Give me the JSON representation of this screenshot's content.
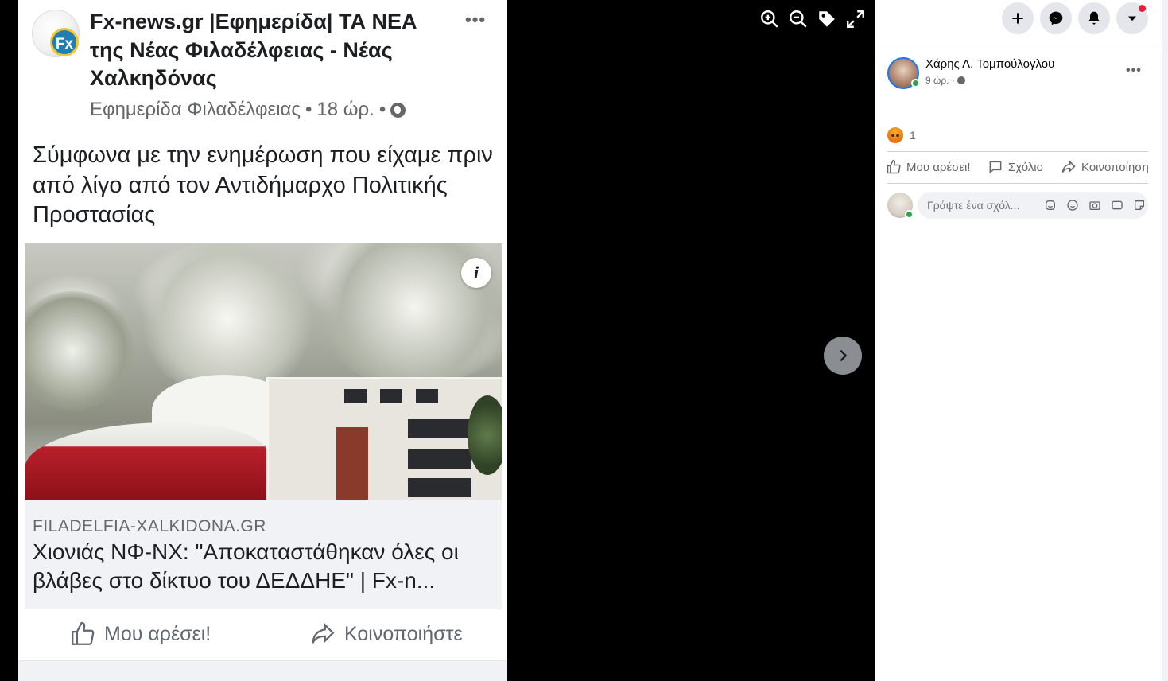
{
  "post": {
    "page_name": "Fx-news.gr |Εφημερίδα| ΤΑ ΝΕΑ της Νέας Φιλαδέλφειας - Νέας Χαλκηδόνας",
    "logo_text": "Fx",
    "byline": "Εφημερίδα Φιλαδέλφειας",
    "time": "18 ώρ.",
    "separator": "•",
    "body": "Σύμφωνα με την ενημέρωση που είχαμε πριν από λίγο από τον Αντιδήμαρχο Πολιτικής Προστασίας",
    "link": {
      "domain": "FILADELFIA-XALKIDONA.GR",
      "title": "Χιονιάς ΝΦ-ΝΧ: \"Αποκαταστάθηκαν όλες οι βλάβες στο δίκτυο του ΔΕΔΔΗΕ\" | Fx-n..."
    },
    "actions": {
      "like": "Μου αρέσει!",
      "share": "Κοινοποιήστε"
    }
  },
  "viewer": {
    "tools": [
      "zoom-in-icon",
      "zoom-out-icon",
      "tag-icon",
      "fullscreen-icon"
    ]
  },
  "panel": {
    "author": "Χάρης Λ. Τομπούλογλου",
    "time": "9 ώρ. ·",
    "reactions": {
      "type": "angry",
      "count": "1"
    },
    "actions": {
      "like": "Μου αρέσει!",
      "comment": "Σχόλιο",
      "share": "Κοινοποίηση"
    },
    "comment_placeholder": "Γράψτε ένα σχόλ..."
  },
  "colors": {
    "accent": "#1877f2",
    "notification": "#e41e3f",
    "online": "#31a24c"
  }
}
